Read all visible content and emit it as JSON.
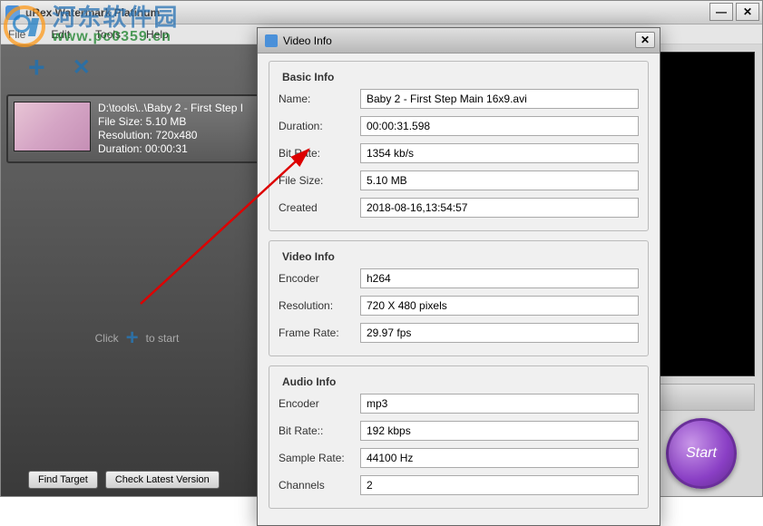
{
  "app_title": "uRex Watermark Platinum",
  "menu": {
    "file": "File",
    "edit": "Edit",
    "tools": "Tools",
    "help": "Help"
  },
  "file_item": {
    "path": "D:\\tools\\..\\Baby 2 - First Step I",
    "size_label": "File Size: 5.10 MB",
    "resolution_label": "Resolution: 720x480",
    "duration_label": "Duration: 00:00:31"
  },
  "hint": {
    "click": "Click",
    "to_start": "to start"
  },
  "buttons": {
    "find_target": "Find Target",
    "check_version": "Check Latest Version",
    "start": "Start"
  },
  "watermark": {
    "cn": "河东软件园",
    "url": "www.pc0359.cn"
  },
  "modal": {
    "title": "Video Info",
    "sections": {
      "basic": {
        "legend": "Basic Info",
        "name_label": "Name:",
        "name": "Baby 2 - First Step Main 16x9.avi",
        "duration_label": "Duration:",
        "duration": "00:00:31.598",
        "bitrate_label": "Bit Rate:",
        "bitrate": "1354 kb/s",
        "filesize_label": "File Size:",
        "filesize": "5.10 MB",
        "created_label": "Created",
        "created": "2018-08-16,13:54:57"
      },
      "video": {
        "legend": "Video Info",
        "encoder_label": "Encoder",
        "encoder": "h264",
        "resolution_label": "Resolution:",
        "resolution": "720 X 480 pixels",
        "framerate_label": "Frame Rate:",
        "framerate": "29.97 fps"
      },
      "audio": {
        "legend": "Audio Info",
        "encoder_label": "Encoder",
        "encoder": "mp3",
        "bitrate_label": "Bit Rate::",
        "bitrate": "192 kbps",
        "samplerate_label": "Sample Rate:",
        "samplerate": "44100 Hz",
        "channels_label": "Channels",
        "channels": "2"
      }
    }
  }
}
